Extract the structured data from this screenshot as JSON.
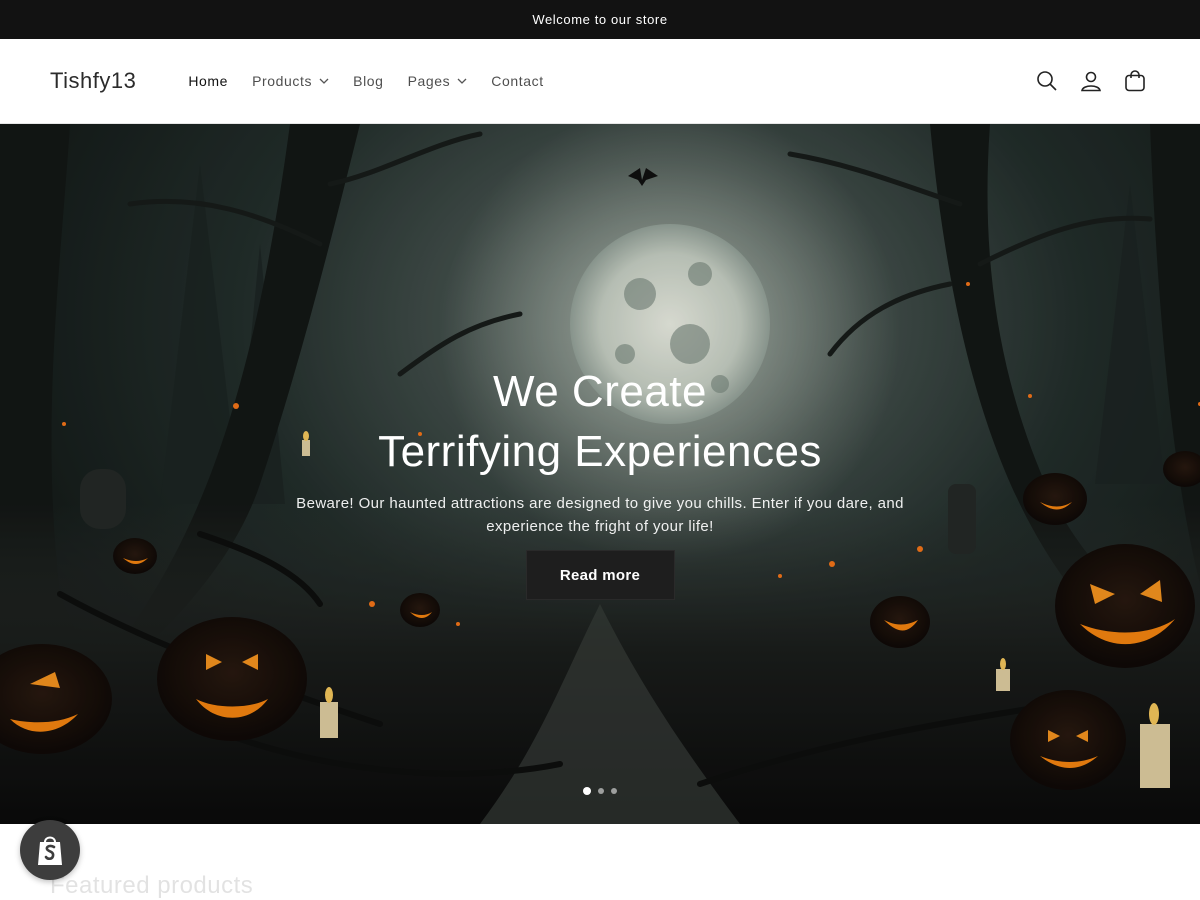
{
  "announcement": {
    "text": "Welcome to our store"
  },
  "header": {
    "logo": "Tishfy13",
    "nav": [
      {
        "label": "Home",
        "has_dropdown": false,
        "active": true
      },
      {
        "label": "Products",
        "has_dropdown": true
      },
      {
        "label": "Blog",
        "has_dropdown": false
      },
      {
        "label": "Pages",
        "has_dropdown": true
      },
      {
        "label": "Contact",
        "has_dropdown": false
      }
    ],
    "icons": [
      "search-icon",
      "account-icon",
      "cart-icon"
    ]
  },
  "hero": {
    "title_line1": "We Create",
    "title_line2": "Terrifying Experiences",
    "text": "Beware! Our haunted attractions are designed to give you chills. Enter if you dare, and experience the fright of your life!",
    "button": "Read more",
    "slides": 3,
    "active_slide": 1
  },
  "featured": {
    "heading": "Featured products"
  },
  "colors": {
    "topbar": "#121212",
    "button": "#1e1e1e",
    "pumpkin": "#e86a10"
  }
}
